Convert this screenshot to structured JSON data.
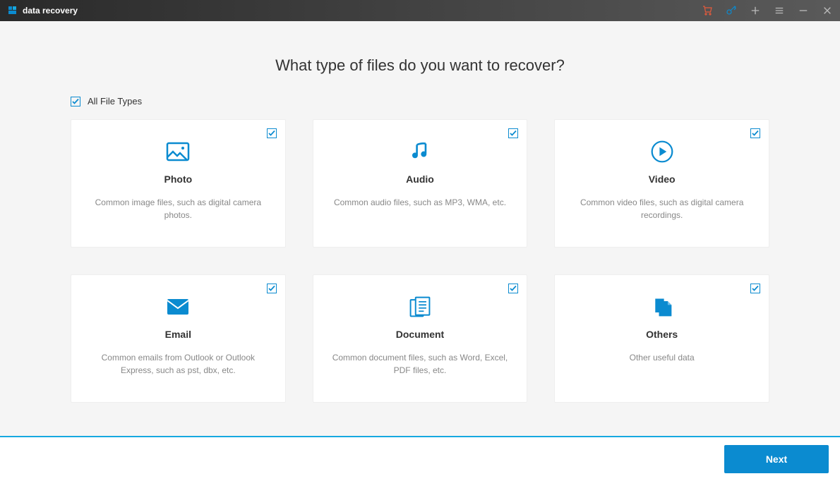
{
  "app_name": "data recovery",
  "heading": "What type of files do you want to recover?",
  "all_label": "All File Types",
  "next_label": "Next",
  "colors": {
    "accent": "#0b8bd0",
    "cart": "#e55a3c"
  },
  "cards": [
    {
      "title": "Photo",
      "desc": "Common image files, such as digital camera photos.",
      "icon": "photo"
    },
    {
      "title": "Audio",
      "desc": "Common audio files, such as MP3, WMA, etc.",
      "icon": "audio"
    },
    {
      "title": "Video",
      "desc": "Common video files, such as digital camera recordings.",
      "icon": "video"
    },
    {
      "title": "Email",
      "desc": "Common emails from Outlook or Outlook Express, such as pst, dbx, etc.",
      "icon": "email"
    },
    {
      "title": "Document",
      "desc": "Common document files, such as Word, Excel, PDF files, etc.",
      "icon": "document"
    },
    {
      "title": "Others",
      "desc": "Other useful data",
      "icon": "others"
    }
  ]
}
